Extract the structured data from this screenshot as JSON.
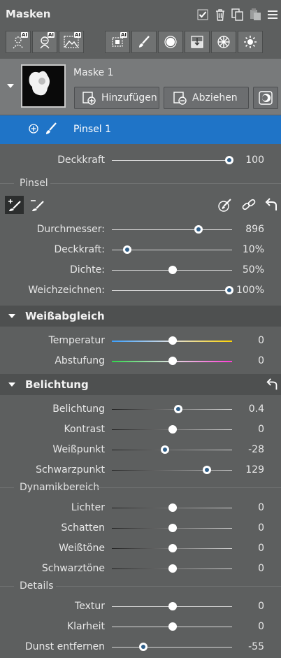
{
  "header": {
    "title": "Masken",
    "icons": [
      "checkbox-icon",
      "trash-icon",
      "copy-icon",
      "paste-icon",
      "menu-icon"
    ]
  },
  "tools": {
    "group1": [
      "ai-person-mask-icon",
      "ai-person-detail-mask-icon",
      "ai-landscape-mask-icon"
    ],
    "group2": [
      "ai-object-select-icon",
      "brush-icon",
      "radial-gradient-icon",
      "linear-gradient-icon",
      "color-range-icon",
      "luminance-range-icon"
    ]
  },
  "mask": {
    "name": "Maske 1",
    "add_label": "Hinzufügen",
    "subtract_label": "Abziehen"
  },
  "brush_item": {
    "name": "Pinsel 1"
  },
  "opacity": {
    "label": "Deckkraft",
    "value": "100",
    "level": 1.0
  },
  "pinsel": {
    "section_title": "Pinsel",
    "sliders": [
      {
        "label": "Durchmesser:",
        "value": "896",
        "level": 0.73
      },
      {
        "label": "Deckkraft:",
        "value": "10%",
        "level": 0.1
      },
      {
        "label": "Dichte:",
        "value": "50%",
        "level": 0.5
      },
      {
        "label": "Weichzeichnen:",
        "value": "100%",
        "level": 1.0
      }
    ]
  },
  "weissabgleich": {
    "title": "Weißabgleich",
    "sliders": [
      {
        "label": "Temperatur",
        "value": "0",
        "level": 0.5
      },
      {
        "label": "Abstufung",
        "value": "0",
        "level": 0.5
      }
    ]
  },
  "belichtung": {
    "title": "Belichtung",
    "sliders": [
      {
        "label": "Belichtung",
        "value": "0.4",
        "level": 0.55
      },
      {
        "label": "Kontrast",
        "value": "0",
        "level": 0.5
      },
      {
        "label": "Weißpunkt",
        "value": "-28",
        "level": 0.43
      },
      {
        "label": "Schwarzpunkt",
        "value": "129",
        "level": 0.8
      }
    ],
    "dynamik_title": "Dynamikbereich",
    "dynamik": [
      {
        "label": "Lichter",
        "value": "0",
        "level": 0.5
      },
      {
        "label": "Schatten",
        "value": "0",
        "level": 0.5
      },
      {
        "label": "Weißtöne",
        "value": "0",
        "level": 0.5
      },
      {
        "label": "Schwarztöne",
        "value": "0",
        "level": 0.5
      }
    ],
    "details_title": "Details",
    "details": [
      {
        "label": "Textur",
        "value": "0",
        "level": 0.5
      },
      {
        "label": "Klarheit",
        "value": "0",
        "level": 0.5
      },
      {
        "label": "Dunst entfernen",
        "value": "-55",
        "level": 0.24
      }
    ]
  },
  "colors": {
    "accent": "#1f74c7",
    "knob_dot": "#2f5f8a",
    "panel_bg": "#5d5f5f"
  }
}
